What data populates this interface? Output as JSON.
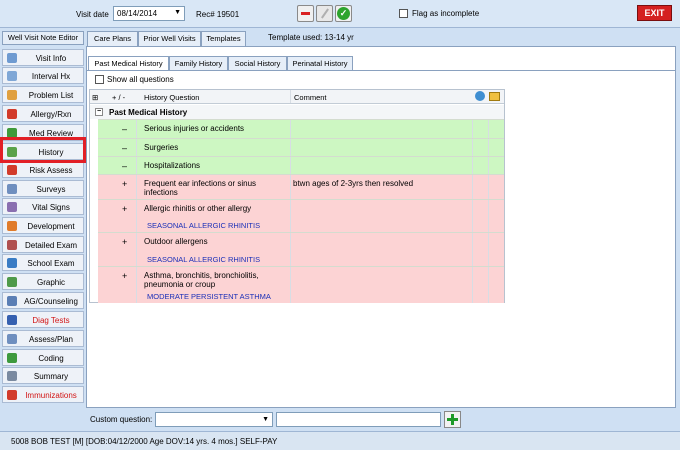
{
  "header": {
    "visit_date_label": "Visit date",
    "visit_date": "08/14/2014",
    "rec_label": "Rec# 19501",
    "flag_label": "Flag as incomplete",
    "exit_label": "EXIT"
  },
  "sidebar": {
    "top_button": "Well Visit Note Editor",
    "items": [
      {
        "label": "Visit Info",
        "icon": "visit-info-icon",
        "color": "#6f9bd1"
      },
      {
        "label": "Interval Hx",
        "icon": "interval-hx-icon",
        "color": "#7fa7d6"
      },
      {
        "label": "Problem List",
        "icon": "problem-list-icon",
        "color": "#e0a040"
      },
      {
        "label": "Allergy/Rxn",
        "icon": "allergy-icon",
        "color": "#d23b2b"
      },
      {
        "label": "Med Review",
        "icon": "med-review-icon",
        "color": "#3f9a3a"
      },
      {
        "label": "History",
        "icon": "history-icon",
        "color": "#5aa24a"
      },
      {
        "label": "Risk Assess",
        "icon": "risk-assess-icon",
        "color": "#d23b2b"
      },
      {
        "label": "Surveys",
        "icon": "surveys-icon",
        "color": "#6f8fbf"
      },
      {
        "label": "Vital Signs",
        "icon": "vital-signs-icon",
        "color": "#8a6fb0"
      },
      {
        "label": "Development",
        "icon": "development-icon",
        "color": "#e07b2a"
      },
      {
        "label": "Detailed Exam",
        "icon": "detailed-exam-icon",
        "color": "#b05050"
      },
      {
        "label": "School Exam",
        "icon": "school-exam-icon",
        "color": "#3a7cc4"
      },
      {
        "label": "Graphic",
        "icon": "graphic-icon",
        "color": "#4f9a4a"
      },
      {
        "label": "AG/Counseling",
        "icon": "counseling-icon",
        "color": "#5b7fb5"
      },
      {
        "label": "Diag Tests",
        "icon": "diag-tests-icon",
        "color": "#3560b0"
      },
      {
        "label": "Assess/Plan",
        "icon": "assess-plan-icon",
        "color": "#6f8fbf"
      },
      {
        "label": "Coding",
        "icon": "coding-icon",
        "color": "#3e9a3e"
      },
      {
        "label": "Summary",
        "icon": "summary-icon",
        "color": "#7a8aa0"
      },
      {
        "label": "Immunizations",
        "icon": "immunizations-icon",
        "color": "#d23b2b"
      }
    ]
  },
  "top_tabs": [
    "Care Plans",
    "Prior Well Visits",
    "Templates"
  ],
  "template_used": "Template used:  13-14 yr",
  "sub_tabs": [
    "Past Medical History",
    "Family History",
    "Social History",
    "Perinatal History"
  ],
  "show_all_label": "Show all questions",
  "grid": {
    "col_plusminus": "+ / -",
    "col_question": "History Question",
    "col_comment": "Comment",
    "section_title": "Past Medical History",
    "rows": [
      {
        "sign": "–",
        "question": "Serious injuries or accidents",
        "comment": "",
        "note": ""
      },
      {
        "sign": "–",
        "question": "Surgeries",
        "comment": "",
        "note": ""
      },
      {
        "sign": "–",
        "question": "Hospitalizations",
        "comment": "",
        "note": ""
      },
      {
        "sign": "+",
        "question": "Frequent ear infections or sinus infections",
        "comment": "btwn ages of 2-3yrs then resolved",
        "note": ""
      },
      {
        "sign": "+",
        "question": "Allergic rhinitis or other allergy",
        "comment": "",
        "note": "SEASONAL ALLERGIC RHINITIS"
      },
      {
        "sign": "+",
        "question": "Outdoor allergens",
        "comment": "",
        "note": "SEASONAL ALLERGIC RHINITIS"
      },
      {
        "sign": "+",
        "question": "Asthma, bronchitis, bronchiolitis, pneumonia or croup",
        "comment": "",
        "note": "MODERATE PERSISTENT ASTHMA"
      }
    ]
  },
  "custom_question_label": "Custom question:",
  "status_bar": "5008 BOB TEST [M] [DOB:04/12/2000  Age DOV:14 yrs. 4 mos.] SELF-PAY"
}
